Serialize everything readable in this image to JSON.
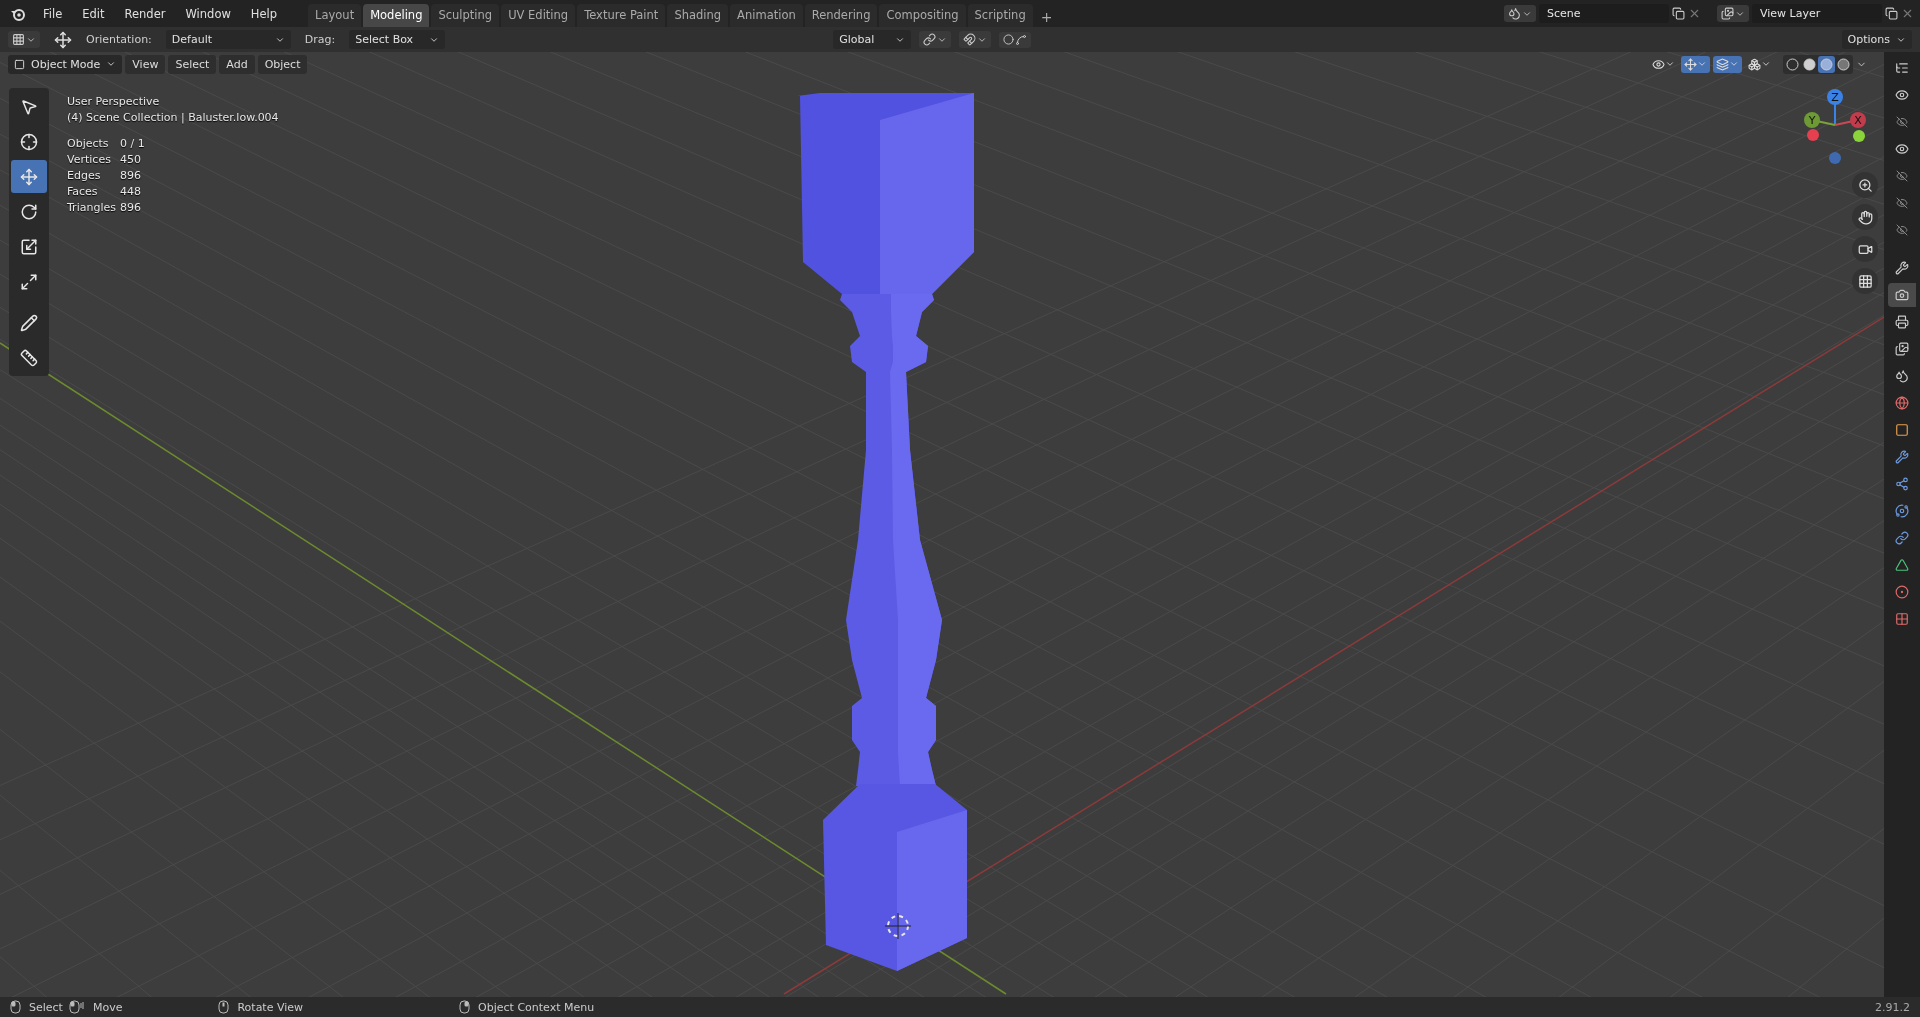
{
  "menu_bar": {
    "menus": [
      "File",
      "Edit",
      "Render",
      "Window",
      "Help"
    ],
    "workspaces": [
      {
        "label": "Layout",
        "selected": false
      },
      {
        "label": "Modeling",
        "selected": true
      },
      {
        "label": "Sculpting",
        "selected": false
      },
      {
        "label": "UV Editing",
        "selected": false
      },
      {
        "label": "Texture Paint",
        "selected": false
      },
      {
        "label": "Shading",
        "selected": false
      },
      {
        "label": "Animation",
        "selected": false
      },
      {
        "label": "Rendering",
        "selected": false
      },
      {
        "label": "Compositing",
        "selected": false
      },
      {
        "label": "Scripting",
        "selected": false
      }
    ],
    "add_workspace": "+",
    "scene": "Scene",
    "view_layer": "View Layer"
  },
  "tool_header": {
    "orientation_label": "Orientation:",
    "orientation": "Default",
    "drag_label": "Drag:",
    "drag": "Select Box",
    "transform_orientation": "Global",
    "options": "Options"
  },
  "viewport_header": {
    "mode": "Object Mode",
    "menus": [
      "View",
      "Select",
      "Add",
      "Object"
    ],
    "toggles": [
      {
        "kind": "visibility",
        "on": false
      },
      {
        "kind": "gizmo",
        "on": true
      },
      {
        "kind": "overlay",
        "on": true
      },
      {
        "kind": "xray",
        "on": false
      }
    ],
    "shading_modes": [
      {
        "kind": "wireframe",
        "selected": false
      },
      {
        "kind": "solid",
        "selected": false
      },
      {
        "kind": "material",
        "selected": true
      },
      {
        "kind": "rendered",
        "selected": false
      }
    ]
  },
  "viewport": {
    "view_name": "User Perspective",
    "collection": "(4) Scene Collection | Baluster.low.004",
    "stats": [
      {
        "label": "Objects",
        "value": "0 / 1"
      },
      {
        "label": "Vertices",
        "value": "450"
      },
      {
        "label": "Edges",
        "value": "896"
      },
      {
        "label": "Faces",
        "value": "448"
      },
      {
        "label": "Triangles",
        "value": "896"
      }
    ],
    "gizmo": {
      "x": "X",
      "y": "Y",
      "z": "Z"
    }
  },
  "toolbar": {
    "tools": [
      {
        "kind": "select_box",
        "selected": false
      },
      {
        "kind": "cursor",
        "selected": false
      },
      {
        "kind": "move",
        "selected": true
      },
      {
        "kind": "rotate",
        "selected": false
      },
      {
        "kind": "scale",
        "selected": false
      },
      {
        "kind": "transform",
        "selected": false
      },
      {
        "kind": "annotate",
        "selected": false
      },
      {
        "kind": "measure",
        "selected": false
      }
    ]
  },
  "outliner_rows": [
    {
      "visible": true
    },
    {
      "visible": false
    },
    {
      "visible": true
    },
    {
      "visible": false
    },
    {
      "visible": false
    },
    {
      "visible": false
    }
  ],
  "properties_tabs": [
    {
      "kind": "tool",
      "selected": false
    },
    {
      "kind": "render",
      "selected": true
    },
    {
      "kind": "output",
      "selected": false
    },
    {
      "kind": "view_layer",
      "selected": false
    },
    {
      "kind": "scene",
      "selected": false
    },
    {
      "kind": "world",
      "selected": false
    },
    {
      "kind": "object",
      "selected": false
    },
    {
      "kind": "modifiers",
      "selected": false
    },
    {
      "kind": "particles",
      "selected": false
    },
    {
      "kind": "physics",
      "selected": false
    },
    {
      "kind": "constraints",
      "selected": false
    },
    {
      "kind": "data",
      "selected": false
    },
    {
      "kind": "material",
      "selected": false
    },
    {
      "kind": "texture",
      "selected": false
    }
  ],
  "status_bar": {
    "hints": [
      {
        "kind": "left",
        "label": "Select"
      },
      {
        "kind": "drag",
        "label": "Move"
      },
      {
        "kind": "middle",
        "label": "Rotate View"
      },
      {
        "kind": "right",
        "label": "Object Context Menu"
      }
    ],
    "version": "2.91.2"
  }
}
